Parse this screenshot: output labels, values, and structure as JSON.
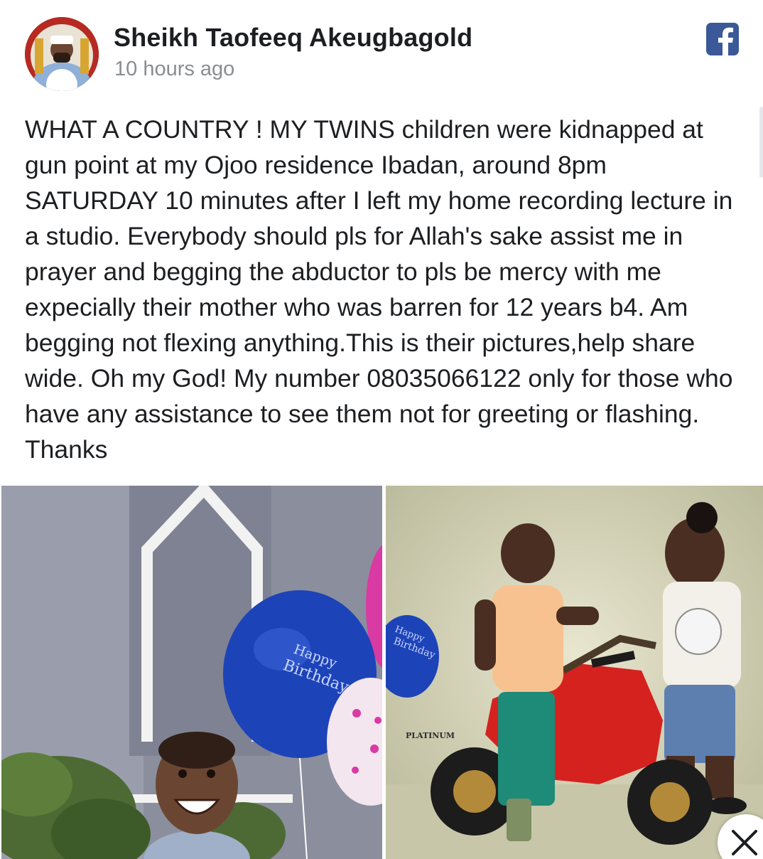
{
  "post": {
    "author": "Sheikh Taofeeq Akeugbagold",
    "timestamp": "10 hours ago",
    "body": "WHAT A COUNTRY ! MY TWINS children were kidnapped at gun point at my Ojoo residence Ibadan, around 8pm SATURDAY 10 minutes after I left my home recording lecture in a studio. Everybody should pls for Allah's sake assist me in prayer and begging the abductor to pls be mercy with me expecially their mother who was barren for 12 years b4. Am begging not flexing anything.This is their pictures,help share wide. Oh my God! My number 08035066122 only for those who have any assistance to see them not for greeting or flashing. Thanks"
  },
  "photos": {
    "left": {
      "balloon_text_1": "Happy",
      "balloon_text_2": "Birthday"
    },
    "right": {
      "balloon_text_1": "Happy",
      "balloon_text_2": "Birthday",
      "watermark": "PLATINUM"
    }
  },
  "icons": {
    "platform": "facebook-icon",
    "close": "close-icon"
  },
  "colors": {
    "facebook_blue": "#3b5998",
    "text": "#1c1e21",
    "muted": "#8a8d91"
  }
}
